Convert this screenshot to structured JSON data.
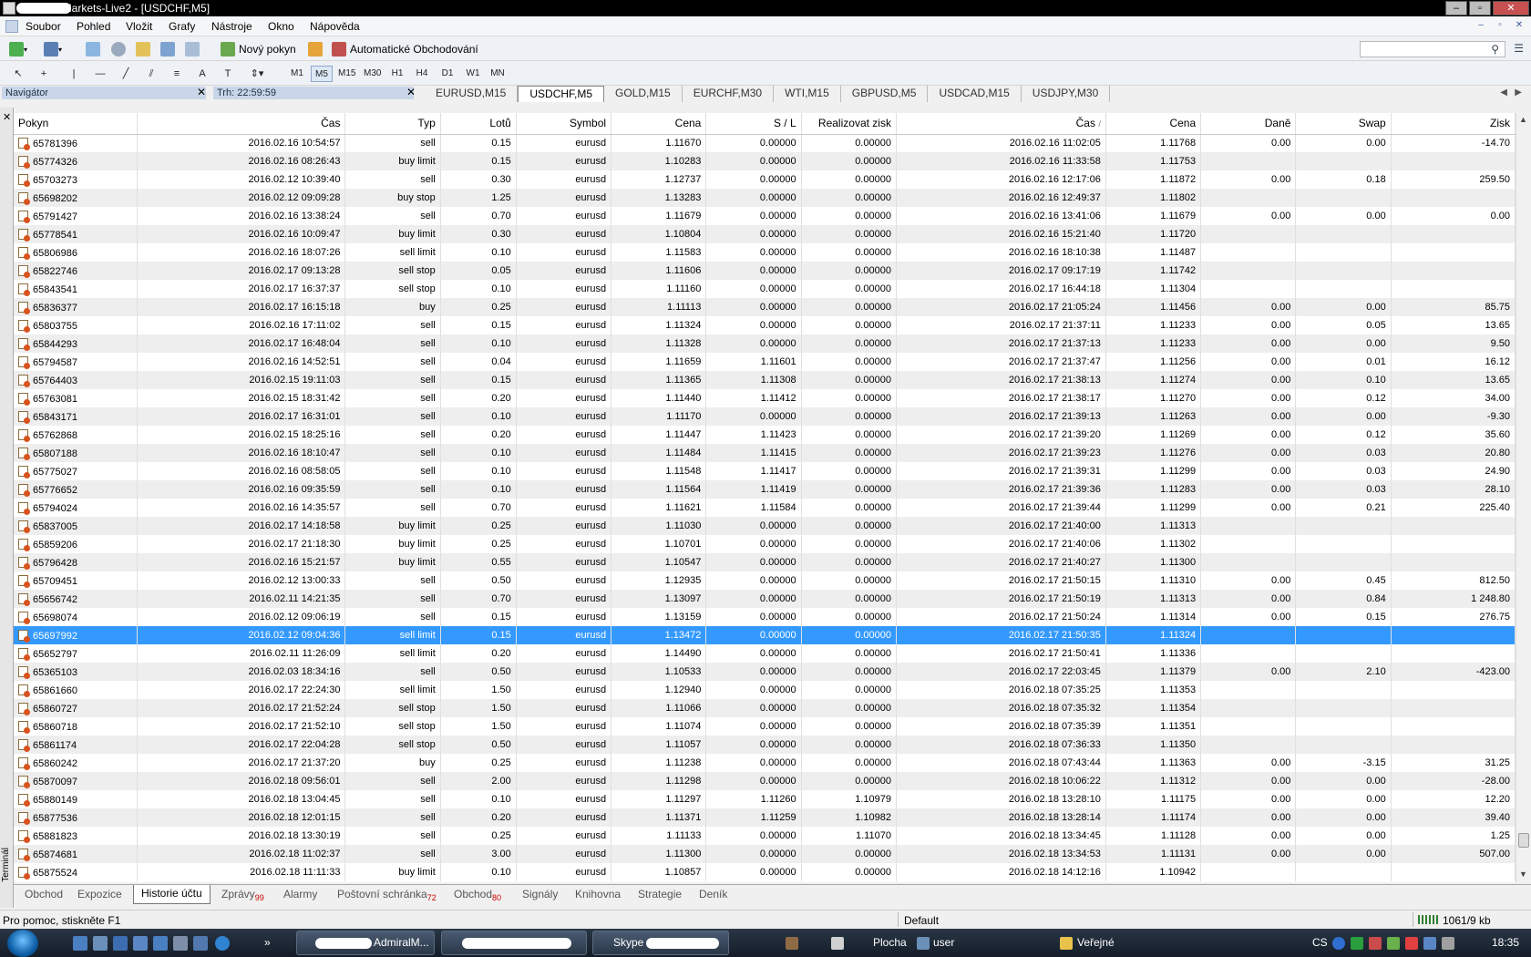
{
  "window": {
    "title": "AdmiralMarkets-Live2 - [USDCHF,M5]",
    "controls": [
      "–",
      "▫",
      "✕"
    ]
  },
  "menu": [
    "Soubor",
    "Pohled",
    "Vložit",
    "Grafy",
    "Nástroje",
    "Okno",
    "Nápověda"
  ],
  "toolbar": {
    "new_order_label": "Nový pokyn",
    "auto_trading_label": "Automatické Obchodování"
  },
  "timeframes": [
    "M1",
    "M5",
    "M15",
    "M30",
    "H1",
    "H4",
    "D1",
    "W1",
    "MN"
  ],
  "active_timeframe": "M5",
  "panels": {
    "navigator_title": "Navigátor",
    "market_title": "Trh: 22:59:59"
  },
  "chart_tabs": [
    "EURUSD,M15",
    "USDCHF,M5",
    "GOLD,M15",
    "EURCHF,M30",
    "WTI,M15",
    "GBPUSD,M5",
    "USDCAD,M15",
    "USDJPY,M30"
  ],
  "active_chart_tab": "USDCHF,M5",
  "table": {
    "columns": [
      "Pokyn",
      "Čas",
      "Typ",
      "Lotů",
      "Symbol",
      "Cena",
      "S / L",
      "Realizovat zisk",
      "Čas",
      "Cena",
      "Daně",
      "Swap",
      "Zisk"
    ],
    "sort_indicator": "/",
    "selected_index": 27,
    "rows": [
      [
        "65781396",
        "2016.02.16 10:54:57",
        "sell",
        "0.15",
        "eurusd",
        "1.11670",
        "0.00000",
        "0.00000",
        "2016.02.16 11:02:05",
        "1.11768",
        "0.00",
        "0.00",
        "-14.70"
      ],
      [
        "65774326",
        "2016.02.16 08:26:43",
        "buy limit",
        "0.15",
        "eurusd",
        "1.10283",
        "0.00000",
        "0.00000",
        "2016.02.16 11:33:58",
        "1.11753",
        "",
        "",
        ""
      ],
      [
        "65703273",
        "2016.02.12 10:39:40",
        "sell",
        "0.30",
        "eurusd",
        "1.12737",
        "0.00000",
        "0.00000",
        "2016.02.16 12:17:06",
        "1.11872",
        "0.00",
        "0.18",
        "259.50"
      ],
      [
        "65698202",
        "2016.02.12 09:09:28",
        "buy stop",
        "1.25",
        "eurusd",
        "1.13283",
        "0.00000",
        "0.00000",
        "2016.02.16 12:49:37",
        "1.11802",
        "",
        "",
        ""
      ],
      [
        "65791427",
        "2016.02.16 13:38:24",
        "sell",
        "0.70",
        "eurusd",
        "1.11679",
        "0.00000",
        "0.00000",
        "2016.02.16 13:41:06",
        "1.11679",
        "0.00",
        "0.00",
        "0.00"
      ],
      [
        "65778541",
        "2016.02.16 10:09:47",
        "buy limit",
        "0.30",
        "eurusd",
        "1.10804",
        "0.00000",
        "0.00000",
        "2016.02.16 15:21:40",
        "1.11720",
        "",
        "",
        ""
      ],
      [
        "65806986",
        "2016.02.16 18:07:26",
        "sell limit",
        "0.10",
        "eurusd",
        "1.11583",
        "0.00000",
        "0.00000",
        "2016.02.16 18:10:38",
        "1.11487",
        "",
        "",
        ""
      ],
      [
        "65822746",
        "2016.02.17 09:13:28",
        "sell stop",
        "0.05",
        "eurusd",
        "1.11606",
        "0.00000",
        "0.00000",
        "2016.02.17 09:17:19",
        "1.11742",
        "",
        "",
        ""
      ],
      [
        "65843541",
        "2016.02.17 16:37:37",
        "sell stop",
        "0.10",
        "eurusd",
        "1.11160",
        "0.00000",
        "0.00000",
        "2016.02.17 16:44:18",
        "1.11304",
        "",
        "",
        ""
      ],
      [
        "65836377",
        "2016.02.17 16:15:18",
        "buy",
        "0.25",
        "eurusd",
        "1.11113",
        "0.00000",
        "0.00000",
        "2016.02.17 21:05:24",
        "1.11456",
        "0.00",
        "0.00",
        "85.75"
      ],
      [
        "65803755",
        "2016.02.16 17:11:02",
        "sell",
        "0.15",
        "eurusd",
        "1.11324",
        "0.00000",
        "0.00000",
        "2016.02.17 21:37:11",
        "1.11233",
        "0.00",
        "0.05",
        "13.65"
      ],
      [
        "65844293",
        "2016.02.17 16:48:04",
        "sell",
        "0.10",
        "eurusd",
        "1.11328",
        "0.00000",
        "0.00000",
        "2016.02.17 21:37:13",
        "1.11233",
        "0.00",
        "0.00",
        "9.50"
      ],
      [
        "65794587",
        "2016.02.16 14:52:51",
        "sell",
        "0.04",
        "eurusd",
        "1.11659",
        "1.11601",
        "0.00000",
        "2016.02.17 21:37:47",
        "1.11256",
        "0.00",
        "0.01",
        "16.12"
      ],
      [
        "65764403",
        "2016.02.15 19:11:03",
        "sell",
        "0.15",
        "eurusd",
        "1.11365",
        "1.11308",
        "0.00000",
        "2016.02.17 21:38:13",
        "1.11274",
        "0.00",
        "0.10",
        "13.65"
      ],
      [
        "65763081",
        "2016.02.15 18:31:42",
        "sell",
        "0.20",
        "eurusd",
        "1.11440",
        "1.11412",
        "0.00000",
        "2016.02.17 21:38:17",
        "1.11270",
        "0.00",
        "0.12",
        "34.00"
      ],
      [
        "65843171",
        "2016.02.17 16:31:01",
        "sell",
        "0.10",
        "eurusd",
        "1.11170",
        "0.00000",
        "0.00000",
        "2016.02.17 21:39:13",
        "1.11263",
        "0.00",
        "0.00",
        "-9.30"
      ],
      [
        "65762868",
        "2016.02.15 18:25:16",
        "sell",
        "0.20",
        "eurusd",
        "1.11447",
        "1.11423",
        "0.00000",
        "2016.02.17 21:39:20",
        "1.11269",
        "0.00",
        "0.12",
        "35.60"
      ],
      [
        "65807188",
        "2016.02.16 18:10:47",
        "sell",
        "0.10",
        "eurusd",
        "1.11484",
        "1.11415",
        "0.00000",
        "2016.02.17 21:39:23",
        "1.11276",
        "0.00",
        "0.03",
        "20.80"
      ],
      [
        "65775027",
        "2016.02.16 08:58:05",
        "sell",
        "0.10",
        "eurusd",
        "1.11548",
        "1.11417",
        "0.00000",
        "2016.02.17 21:39:31",
        "1.11299",
        "0.00",
        "0.03",
        "24.90"
      ],
      [
        "65776652",
        "2016.02.16 09:35:59",
        "sell",
        "0.10",
        "eurusd",
        "1.11564",
        "1.11419",
        "0.00000",
        "2016.02.17 21:39:36",
        "1.11283",
        "0.00",
        "0.03",
        "28.10"
      ],
      [
        "65794024",
        "2016.02.16 14:35:57",
        "sell",
        "0.70",
        "eurusd",
        "1.11621",
        "1.11584",
        "0.00000",
        "2016.02.17 21:39:44",
        "1.11299",
        "0.00",
        "0.21",
        "225.40"
      ],
      [
        "65837005",
        "2016.02.17 14:18:58",
        "buy limit",
        "0.25",
        "eurusd",
        "1.11030",
        "0.00000",
        "0.00000",
        "2016.02.17 21:40:00",
        "1.11313",
        "",
        "",
        ""
      ],
      [
        "65859206",
        "2016.02.17 21:18:30",
        "buy limit",
        "0.25",
        "eurusd",
        "1.10701",
        "0.00000",
        "0.00000",
        "2016.02.17 21:40:06",
        "1.11302",
        "",
        "",
        ""
      ],
      [
        "65796428",
        "2016.02.16 15:21:57",
        "buy limit",
        "0.55",
        "eurusd",
        "1.10547",
        "0.00000",
        "0.00000",
        "2016.02.17 21:40:27",
        "1.11300",
        "",
        "",
        ""
      ],
      [
        "65709451",
        "2016.02.12 13:00:33",
        "sell",
        "0.50",
        "eurusd",
        "1.12935",
        "0.00000",
        "0.00000",
        "2016.02.17 21:50:15",
        "1.11310",
        "0.00",
        "0.45",
        "812.50"
      ],
      [
        "65656742",
        "2016.02.11 14:21:35",
        "sell",
        "0.70",
        "eurusd",
        "1.13097",
        "0.00000",
        "0.00000",
        "2016.02.17 21:50:19",
        "1.11313",
        "0.00",
        "0.84",
        "1 248.80"
      ],
      [
        "65698074",
        "2016.02.12 09:06:19",
        "sell",
        "0.15",
        "eurusd",
        "1.13159",
        "0.00000",
        "0.00000",
        "2016.02.17 21:50:24",
        "1.11314",
        "0.00",
        "0.15",
        "276.75"
      ],
      [
        "65697992",
        "2016.02.12 09:04:36",
        "sell limit",
        "0.15",
        "eurusd",
        "1.13472",
        "0.00000",
        "0.00000",
        "2016.02.17 21:50:35",
        "1.11324",
        "",
        "",
        ""
      ],
      [
        "65652797",
        "2016.02.11 11:26:09",
        "sell limit",
        "0.20",
        "eurusd",
        "1.14490",
        "0.00000",
        "0.00000",
        "2016.02.17 21:50:41",
        "1.11336",
        "",
        "",
        ""
      ],
      [
        "65365103",
        "2016.02.03 18:34:16",
        "sell",
        "0.50",
        "eurusd",
        "1.10533",
        "0.00000",
        "0.00000",
        "2016.02.17 22:03:45",
        "1.11379",
        "0.00",
        "2.10",
        "-423.00"
      ],
      [
        "65861660",
        "2016.02.17 22:24:30",
        "sell limit",
        "1.50",
        "eurusd",
        "1.12940",
        "0.00000",
        "0.00000",
        "2016.02.18 07:35:25",
        "1.11353",
        "",
        "",
        ""
      ],
      [
        "65860727",
        "2016.02.17 21:52:24",
        "sell stop",
        "1.50",
        "eurusd",
        "1.11066",
        "0.00000",
        "0.00000",
        "2016.02.18 07:35:32",
        "1.11354",
        "",
        "",
        ""
      ],
      [
        "65860718",
        "2016.02.17 21:52:10",
        "sell stop",
        "1.50",
        "eurusd",
        "1.11074",
        "0.00000",
        "0.00000",
        "2016.02.18 07:35:39",
        "1.11351",
        "",
        "",
        ""
      ],
      [
        "65861174",
        "2016.02.17 22:04:28",
        "sell stop",
        "0.50",
        "eurusd",
        "1.11057",
        "0.00000",
        "0.00000",
        "2016.02.18 07:36:33",
        "1.11350",
        "",
        "",
        ""
      ],
      [
        "65860242",
        "2016.02.17 21:37:20",
        "buy",
        "0.25",
        "eurusd",
        "1.11238",
        "0.00000",
        "0.00000",
        "2016.02.18 07:43:44",
        "1.11363",
        "0.00",
        "-3.15",
        "31.25"
      ],
      [
        "65870097",
        "2016.02.18 09:56:01",
        "sell",
        "2.00",
        "eurusd",
        "1.11298",
        "0.00000",
        "0.00000",
        "2016.02.18 10:06:22",
        "1.11312",
        "0.00",
        "0.00",
        "-28.00"
      ],
      [
        "65880149",
        "2016.02.18 13:04:45",
        "sell",
        "0.10",
        "eurusd",
        "1.11297",
        "1.11260",
        "1.10979",
        "2016.02.18 13:28:10",
        "1.11175",
        "0.00",
        "0.00",
        "12.20"
      ],
      [
        "65877536",
        "2016.02.18 12:01:15",
        "sell",
        "0.20",
        "eurusd",
        "1.11371",
        "1.11259",
        "1.10982",
        "2016.02.18 13:28:14",
        "1.11174",
        "0.00",
        "0.00",
        "39.40"
      ],
      [
        "65881823",
        "2016.02.18 13:30:19",
        "sell",
        "0.25",
        "eurusd",
        "1.11133",
        "0.00000",
        "1.11070",
        "2016.02.18 13:34:45",
        "1.11128",
        "0.00",
        "0.00",
        "1.25"
      ],
      [
        "65874681",
        "2016.02.18 11:02:37",
        "sell",
        "3.00",
        "eurusd",
        "1.11300",
        "0.00000",
        "0.00000",
        "2016.02.18 13:34:53",
        "1.11131",
        "0.00",
        "0.00",
        "507.00"
      ],
      [
        "65875524",
        "2016.02.18 11:11:33",
        "buy limit",
        "0.10",
        "eurusd",
        "1.10857",
        "0.00000",
        "0.00000",
        "2016.02.18 14:12:16",
        "1.10942",
        "",
        "",
        ""
      ]
    ]
  },
  "terminal_label": "Terminál",
  "bottom_tabs": [
    {
      "label": "Obchod",
      "badge": ""
    },
    {
      "label": "Expozice",
      "badge": ""
    },
    {
      "label": "Historie účtu",
      "badge": ""
    },
    {
      "label": "Zprávy",
      "badge": "99"
    },
    {
      "label": "Alarmy",
      "badge": ""
    },
    {
      "label": "Poštovní schránka",
      "badge": "72"
    },
    {
      "label": "Obchod",
      "badge": "80"
    },
    {
      "label": "Signály",
      "badge": ""
    },
    {
      "label": "Knihovna",
      "badge": ""
    },
    {
      "label": "Strategie",
      "badge": ""
    },
    {
      "label": "Deník",
      "badge": ""
    }
  ],
  "active_bottom_tab": "Historie účtu",
  "status": {
    "help": "Pro pomoc, stiskněte F1",
    "profile": "Default",
    "traffic": "1061/9 kb"
  },
  "taskbar": {
    "task_admiral": ": AdmiralM...",
    "task_skype": "Skype",
    "desktop": "Plocha",
    "user": "user",
    "public": "Veřejné",
    "lang": "CS",
    "clock": "18:35"
  },
  "colors": {
    "selection": "#3399ff",
    "alt_row": "#eeeeee",
    "badge": "#cc0000"
  },
  "icons": [
    "search-icon",
    "new-chart-icon",
    "new-order-icon",
    "auto-trading-icon",
    "cursor-icon",
    "crosshair-icon",
    "close-icon",
    "order-icon"
  ]
}
